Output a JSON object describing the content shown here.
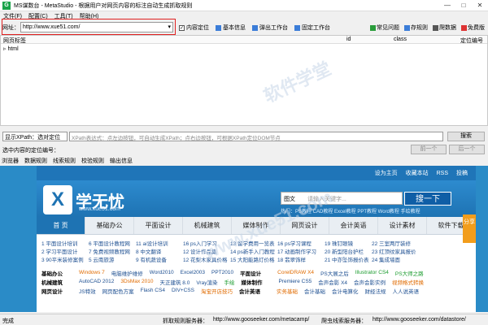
{
  "window": {
    "icon": "G",
    "title": "MS谋数台 - MetaStudio - 根据用户对网页内容的标注自动生成抓取规则",
    "controls": [
      "—",
      "□",
      "✕"
    ]
  },
  "menu": [
    "文件(F)",
    "配置(C)",
    "工具(T)",
    "帮助(H)"
  ],
  "toolbar": {
    "url_label": "网址：",
    "url_value": "http://www.xue51.com/",
    "content_locate": "内容定位",
    "basic_info": "基本信息",
    "popup_work": "弹出工作台",
    "fixed_work": "固定工作台",
    "faq": "常见问题",
    "save_rule": "存规则",
    "crawl_data": "爬数据",
    "free_version": "免费版"
  },
  "tree": {
    "col_tag": "网页标签",
    "col_id": "id",
    "col_class": "class",
    "col_locnum": "定位编号",
    "root": "html"
  },
  "xpath": {
    "select_value": "显示XPath：选对定位",
    "placeholder": "XPath表达式：点左边按钮，可自动生成XPath；点右边按钮，可根据XPath定位DOM节点",
    "search": "搜索",
    "selected_label": "选中内容的定位编号：",
    "prev": "前一个",
    "next": "后一个"
  },
  "tabs": [
    "浏览器",
    "数据规则",
    "线索规则",
    "校验规则",
    "输出信息"
  ],
  "site": {
    "top_links": [
      "设为主页",
      "收藏本站",
      "RSS",
      "投稿"
    ],
    "logo_badge": "X",
    "logo_text": "学无忧",
    "logo_url": "www.xue51.com",
    "search_category": "图文",
    "search_placeholder": "请输入关键字...",
    "search_button": "搜一下",
    "hot_text": "热门：PS教程 CAD教程 Excel教程 PPT教程 Word教程 手绘教程",
    "nav": [
      "首 页",
      "基础办公",
      "平面设计",
      "机械建筑",
      "媒体制作",
      "网页设计",
      "会计英语",
      "设计素材",
      "软件下载"
    ],
    "share": "分享",
    "link_rows": [
      [
        "1 平面设计培训",
        "6 平面设计教程网",
        "11 ai设计培训",
        "16 ps入门学习",
        "13 留学费用一览表",
        "16 ps学习课程",
        "19 珠钉眼镜",
        "22 三室两厅装修"
      ],
      [
        "2 学习平面设计",
        "7 免费视频教程网",
        "8 中文翻译",
        "12 设计作品集",
        "14 ps新手入门教程",
        "17 动画制作学习",
        "20 新型阳台护栏",
        "23 红顶纹家具报价"
      ],
      [
        "3 90平米装修案例",
        "5 云南旅游",
        "9 有机蔬设备",
        "12 花梨木家具价格",
        "15 大阳能路灯价格",
        "18 翡翠饰样",
        "21 中亦坠饰报价表",
        "24 集成墙面"
      ]
    ],
    "cat_rows": [
      {
        "label": "基础办公",
        "items": [
          "Windows 7",
          "电脑维护维修",
          "Word2010",
          "Excel2003",
          "PPT2010"
        ],
        "label2": "平面设计",
        "items2": [
          "CorelDRAW X4",
          "PS大展之后",
          "Illustrator CS4",
          "PS大师之路"
        ]
      },
      {
        "label": "机械建筑",
        "items": [
          "AutoCAD 2012",
          "3DsMax 2010",
          "天正建筑 8.0",
          "Vray渲染",
          "手绘"
        ],
        "label2": "媒体制作",
        "items2": [
          "Premiere CS5",
          "会声会影 X4",
          "会声会影实例",
          "视频格式转换"
        ]
      },
      {
        "label": "网页设计",
        "items": [
          "JS特效",
          "网页配色方案",
          "Flash CS4",
          "DIV+CSS",
          "淘宝开店技巧"
        ],
        "label2": "会计英语",
        "items2": [
          "实务基础",
          "会计基础",
          "会计电算化",
          "财经法规",
          "人人说英语"
        ]
      }
    ]
  },
  "status": {
    "done": "完成",
    "left_label": "抓取规则服务器：",
    "left_url": "http://www.gooseeker.com/metacamp/",
    "right_label": "爬虫线索服务器：",
    "right_url": "http://www.gooseeker.com/datastore/"
  },
  "watermark": [
    "软件学堂",
    "www.xue51.com"
  ],
  "colors": {
    "accent": "#1e73b3",
    "highlight": "#e02020",
    "share": "#f29d1c"
  }
}
